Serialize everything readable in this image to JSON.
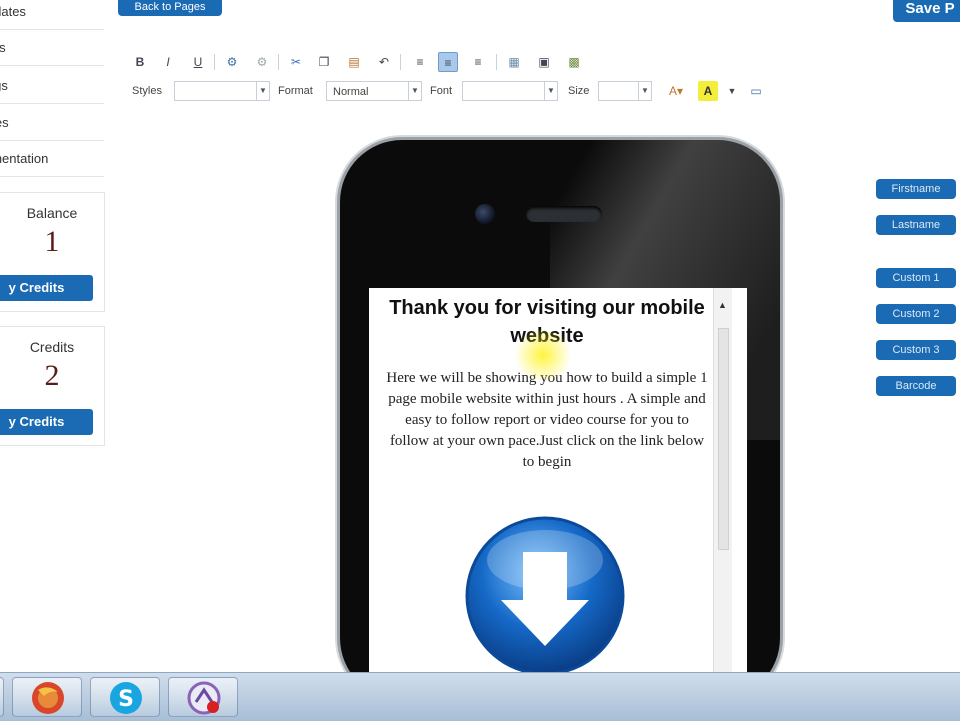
{
  "sidebar": {
    "links": [
      "nplates",
      "orts",
      "ings",
      "ates",
      "umentation"
    ],
    "balance": {
      "title": "Balance",
      "value": "1",
      "button": "y Credits"
    },
    "credits": {
      "title": "Credits",
      "value": "2",
      "button": "y Credits"
    }
  },
  "header": {
    "back_button": "Back to Pages",
    "save_button": "Save P"
  },
  "toolbar": {
    "styles_label": "Styles",
    "styles_value": "",
    "format_label": "Format",
    "format_value": "Normal",
    "font_label": "Font",
    "font_value": "",
    "size_label": "Size",
    "size_value": ""
  },
  "field_buttons": [
    "Firstname",
    "Lastname",
    "Custom 1",
    "Custom 2",
    "Custom 3",
    "Barcode"
  ],
  "preview": {
    "title": "Thank you for visiting our mobile website",
    "body": "Here we will be showing you how to build a simple 1 page mobile website within just hours . A simple and easy to follow report or video course for you to follow at your own pace.Just click on the link below to begin",
    "download_icon": "download-arrow-icon"
  },
  "taskbar": {
    "apps": [
      "firefox-icon",
      "skype-icon",
      "recording-app-icon"
    ]
  },
  "colors": {
    "accent": "#1a6ab4",
    "phone": "#0b0b0b",
    "taskbar": "#b9cde2"
  }
}
